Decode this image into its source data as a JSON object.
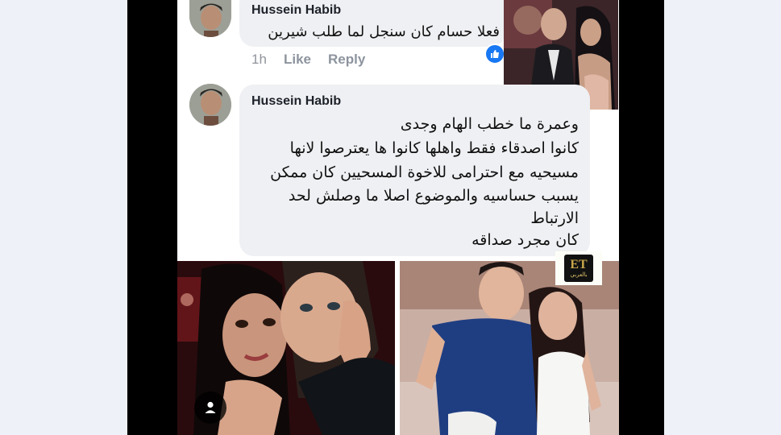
{
  "comments": [
    {
      "author": "Hussein Habib",
      "lines": [
        "فعلا حسام كان سنجل لما طلب شيرين"
      ],
      "actions": {
        "time": "1h",
        "like": "Like",
        "reply": "Reply"
      }
    },
    {
      "author": "Hussein Habib",
      "lines": [
        "وعمرة ما خطب الهام وجدى",
        "كانوا اصدقاء فقط  واهلها كانوا ها يعترصوا لانها",
        "مسيحيه مع احترامى للاخوة المسحيين كان ممكن",
        "يسبب حساسيه والموضوع اصلا ما وصلش لحد",
        "الارتباط",
        "كان مجرد صداقه"
      ]
    }
  ],
  "watermark": {
    "letters": "ET",
    "subtitle": "بالعربي"
  },
  "colors": {
    "accent": "#1877f2",
    "bubble": "#eff0f3",
    "meta": "#90949c"
  },
  "icons": {
    "like_badge": "thumbs-up-icon",
    "profile": "person-icon"
  }
}
